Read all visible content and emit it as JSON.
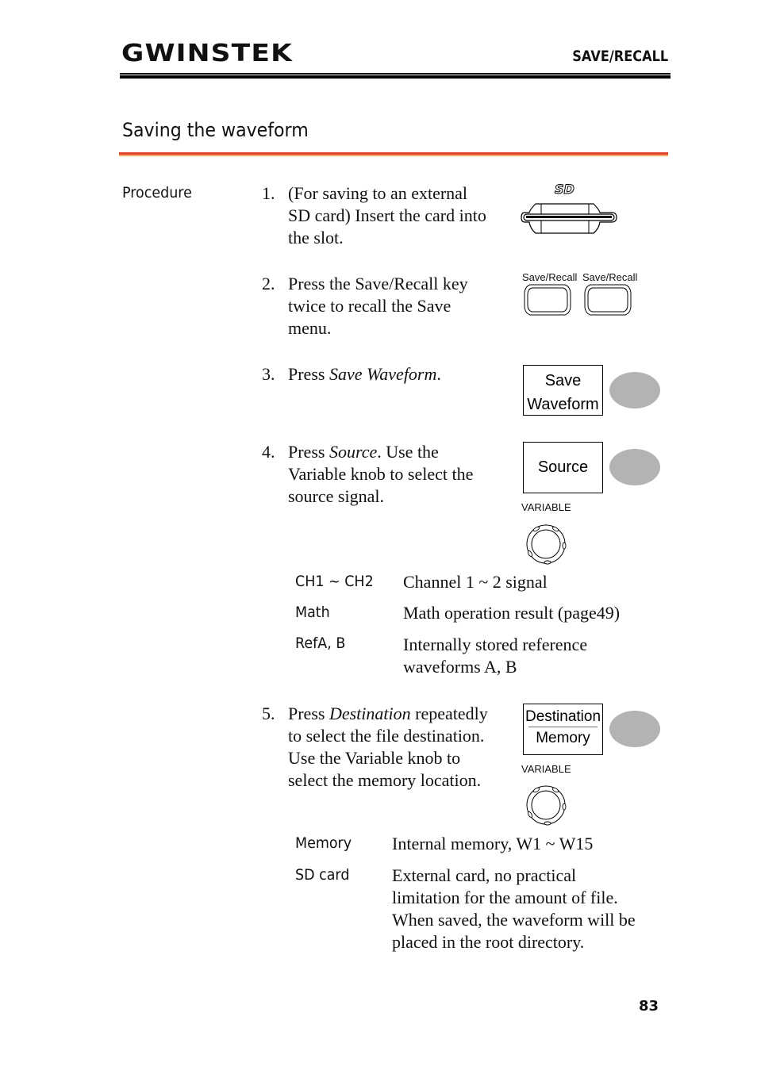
{
  "header": {
    "brand": "GWINSTEK",
    "section": "SAVE/RECALL"
  },
  "title": "Saving the waveform",
  "procedure_label": "Procedure",
  "steps": [
    {
      "num": "1.",
      "lines": [
        "(For saving to an external",
        "SD card) Insert the card into",
        "the slot."
      ]
    },
    {
      "num": "2.",
      "lines": [
        "Press the Save/Recall key",
        "twice to recall the Save",
        "menu."
      ]
    },
    {
      "num": "3.",
      "prefix": "Press ",
      "em": "Save Waveform",
      "suffix": "."
    },
    {
      "num": "4.",
      "line1_prefix": "Press ",
      "line1_em": "Source",
      "line1_suffix": ". Use the",
      "lines": [
        "Variable knob to select the",
        "source signal."
      ]
    },
    {
      "num": "5.",
      "line1_prefix": "Press ",
      "line1_em": "Destination",
      "line1_suffix": " repeatedly",
      "lines": [
        "to select the file destination.",
        "Use the Variable knob to",
        "select the memory location."
      ]
    }
  ],
  "figures": {
    "sd_logo": "SD",
    "save_recall_label_1": "Save/Recall",
    "save_recall_label_2": "Save/Recall",
    "save_waveform_key": [
      "Save",
      "Waveform"
    ],
    "source_key": "Source",
    "variable_label_1": "VARIABLE",
    "destination_key_title": "Destination",
    "destination_key_value": "Memory",
    "variable_label_2": "VARIABLE"
  },
  "source_table": [
    {
      "key": "CH1 ~ CH2",
      "value": [
        "Channel 1 ~ 2 signal"
      ]
    },
    {
      "key": "Math",
      "value": [
        "Math operation result (page49)"
      ]
    },
    {
      "key": "RefA, B",
      "value": [
        "Internally stored reference",
        "waveforms A, B"
      ]
    }
  ],
  "destination_table": [
    {
      "key": "Memory",
      "value": [
        "Internal memory, W1 ~ W15"
      ]
    },
    {
      "key": "SD card",
      "value": [
        "External card, no practical",
        "limitation for the amount of file.",
        "When saved, the waveform will be",
        "placed in the root directory."
      ]
    }
  ],
  "page_number": "83",
  "colors": {
    "title_rule_red": "#e0432a",
    "title_rule_orange": "#f4a76b",
    "button_gray": "#b3b3b3"
  }
}
